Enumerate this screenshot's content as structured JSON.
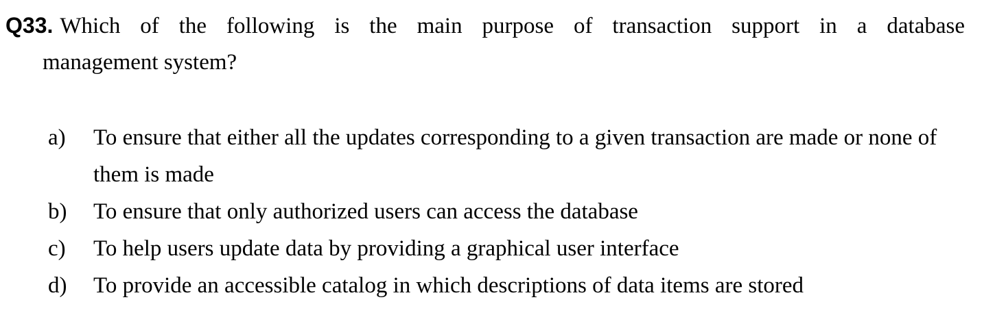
{
  "question": {
    "number": "Q33.",
    "text_line1": "Which of the following is the main purpose of transaction support in a database",
    "text_line2": "management system?"
  },
  "options": [
    {
      "letter": "a)",
      "text": "To ensure that either all the updates corresponding to a given transaction are made or none of them is made"
    },
    {
      "letter": "b)",
      "text": "To ensure that only authorized users can access the database"
    },
    {
      "letter": "c)",
      "text": "To help users update data by providing a graphical user interface"
    },
    {
      "letter": "d)",
      "text": "To provide an accessible catalog in which descriptions of data items are stored"
    }
  ]
}
